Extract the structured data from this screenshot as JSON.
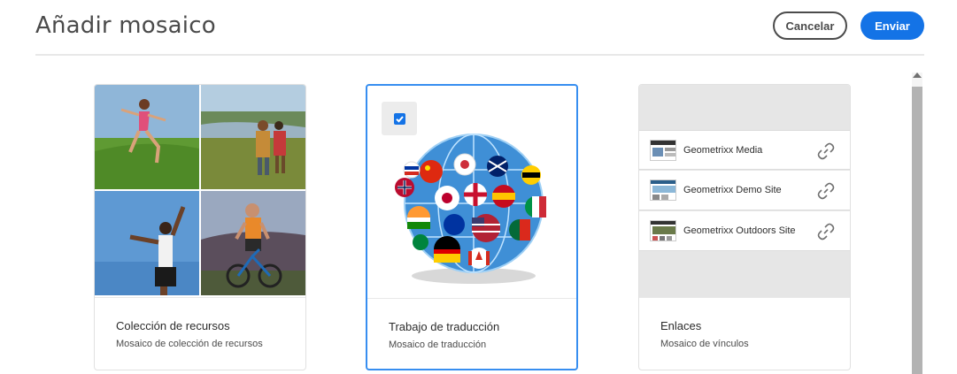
{
  "header": {
    "title": "Añadir mosaico",
    "cancel_label": "Cancelar",
    "send_label": "Enviar"
  },
  "colors": {
    "accent": "#1473e6",
    "selected_border": "#378ef0"
  },
  "cards": [
    {
      "title": "Colección de recursos",
      "subtitle": "Mosaico de colección de recursos",
      "selected": false
    },
    {
      "title": "Trabajo de traducción",
      "subtitle": "Mosaico de traducción",
      "selected": true,
      "icon": "globe-flags-icon"
    },
    {
      "title": "Enlaces",
      "subtitle": "Mosaico de vínculos",
      "selected": false,
      "links": [
        {
          "label": "Geometrixx Media",
          "icon": "link-icon"
        },
        {
          "label": "Geometrixx Demo Site",
          "icon": "link-icon"
        },
        {
          "label": "Geometrixx Outdoors Site",
          "icon": "link-icon"
        }
      ]
    }
  ]
}
